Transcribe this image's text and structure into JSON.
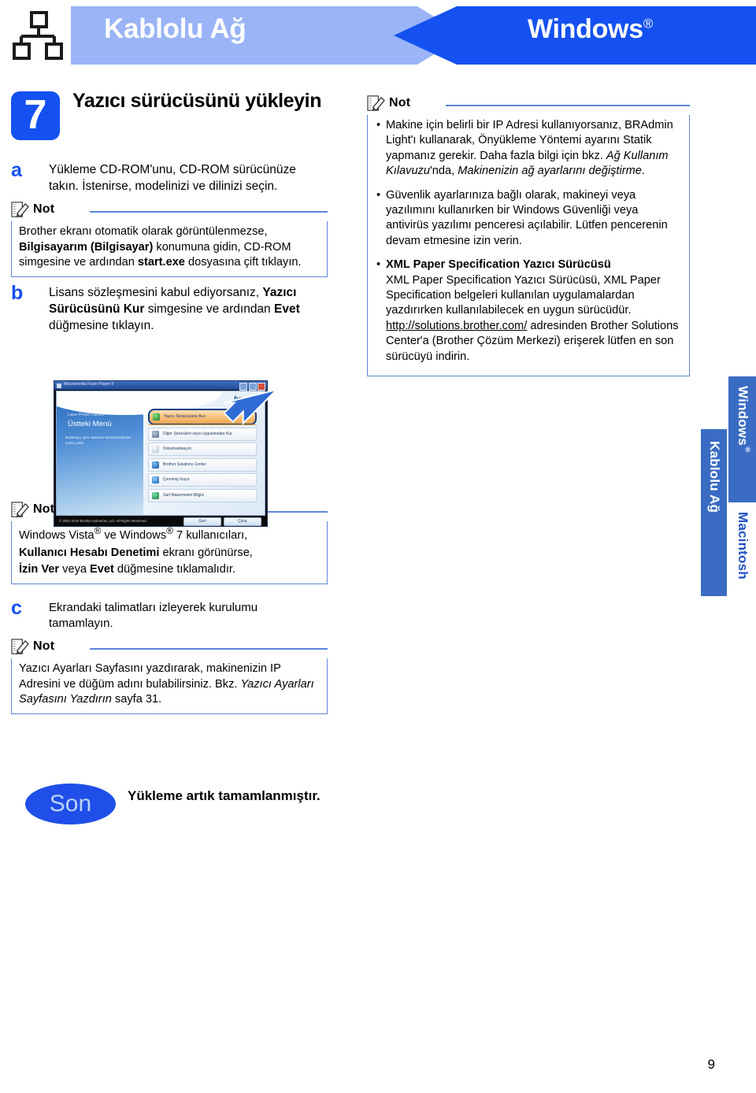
{
  "header": {
    "network_icon": "network-topology-icon",
    "left_title": "Kablolu Ağ",
    "right_title": "Windows",
    "right_title_mark": "®"
  },
  "step": {
    "number": "7",
    "title": "Yazıcı sürücüsünü yükleyin"
  },
  "substeps": [
    {
      "letter": "a",
      "text": "Yükleme CD-ROM'unu, CD-ROM sürücünüze takın. İstenirse, modelinizi ve dilinizi seçin."
    },
    {
      "letter": "b",
      "text_parts": [
        "Lisans sözleşmesini kabul ediyorsanız, ",
        "Yazıcı Sürücüsünü Kur",
        " simgesine ve ardından ",
        "Evet",
        " düğmesine tıklayın."
      ]
    },
    {
      "letter": "c",
      "text": "Ekrandaki talimatları izleyerek kurulumu tamamlayın."
    }
  ],
  "notes": {
    "label": "Not",
    "note_a": {
      "l1": "Brother ekranı otomatik olarak görüntülenmezse,",
      "l2_bold": "Bilgisayarım (Bilgisayar)",
      "l2_rest": " konumuna gidin, CD-ROM simgesine ve ardından ",
      "l2_bold2": "start.exe",
      "l2_rest2": " dosyasına çift tıklayın."
    },
    "note_b": {
      "l1a": "Windows Vista",
      "l1b": " ve Windows",
      "l1c": " 7 kullanıcıları,",
      "l2_bold": "Kullanıcı Hesabı Denetimi",
      "l2_rest": " ekranı görünürse,",
      "l3_bold1": "İzin Ver",
      "l3_mid": " veya ",
      "l3_bold2": "Evet",
      "l3_rest": " düğmesine tıklamalıdır."
    },
    "note_c": {
      "p1": "Yazıcı Ayarları Sayfasını yazdırarak, makinenizin IP Adresini ve düğüm adını bulabilirsiniz. Bkz. ",
      "p1_italic": "Yazıcı Ayarları Sayfasını Yazdırın",
      "p1_end": " sayfa 31."
    },
    "note_right": {
      "bullets": [
        {
          "plain1": "Makine için belirli bir IP Adresi kullanıyorsanız, BRAdmin Light'ı kullanarak, Önyükleme Yöntemi ayarını Statik yapmanız gerekir. Daha fazla bilgi için bkz. ",
          "italic1": "Ağ Kullanım Kılavuzu",
          "plain2": "'nda, ",
          "italic2": "Makinenizin ağ ayarlarını değiştirme",
          "plain3": "."
        },
        {
          "plain1": "Güvenlik ayarlarınıza bağlı olarak, makineyi veya yazılımını kullanırken bir Windows Güvenliği veya antivirüs yazılımı penceresi açılabilir. Lütfen pencerenin devam etmesine izin verin."
        },
        {
          "bold1": "XML Paper Specification Yazıcı Sürücüsü",
          "plain1": "XML Paper Specification Yazıcı Sürücüsü, XML Paper Specification belgeleri kullanılan uygulamalardan yazdırırken kullanılabilecek en uygun sürücüdür.",
          "link": "http://solutions.brother.com/",
          "plain2": " adresinden Brother Solutions Center'a (Brother Çözüm Merkezi) erişerek lütfen en son sürücüyü indirin."
        }
      ]
    }
  },
  "screenshot": {
    "window_title": "Macromedia Flash Player 8",
    "brand": "brother",
    "left_panel_sub": "Laser Printer Utilities",
    "left_panel_title": "Üstteki Menü",
    "left_panel_text": "Başlangıç ayar aşaması tamamlandıktan sonra yüklə",
    "menu_items": [
      "Yazıcı Sürücüsünü Kur",
      "Diğer Sürücüleri veya Uygulamaları Kur",
      "Dokümantasyon",
      "Brother Solutions Center",
      "Çevrimiçi Kayıt",
      "Sarf Malzemeleri Bilgisi"
    ],
    "selected_index": 0,
    "copyright": "© 2001-2010 Brother Industries, Ltd. All Rights Reserved.",
    "back_button": "Geri",
    "exit_button": "Çıkış",
    "annotation": "arrow-pointing-to-install-driver"
  },
  "finish": {
    "badge": "Son",
    "text": "Yükleme artık tamamlanmıştır."
  },
  "side_tabs": {
    "windows": "Windows",
    "windows_mark": "®",
    "macintosh": "Macintosh",
    "wired_network": "Kablolu Ağ"
  },
  "page_number": "9",
  "colors": {
    "accent_blue": "#1451f0",
    "light_blue": "#9ab4f7",
    "note_border": "#5e86d8",
    "tab_blue": "#3a6cc4"
  }
}
